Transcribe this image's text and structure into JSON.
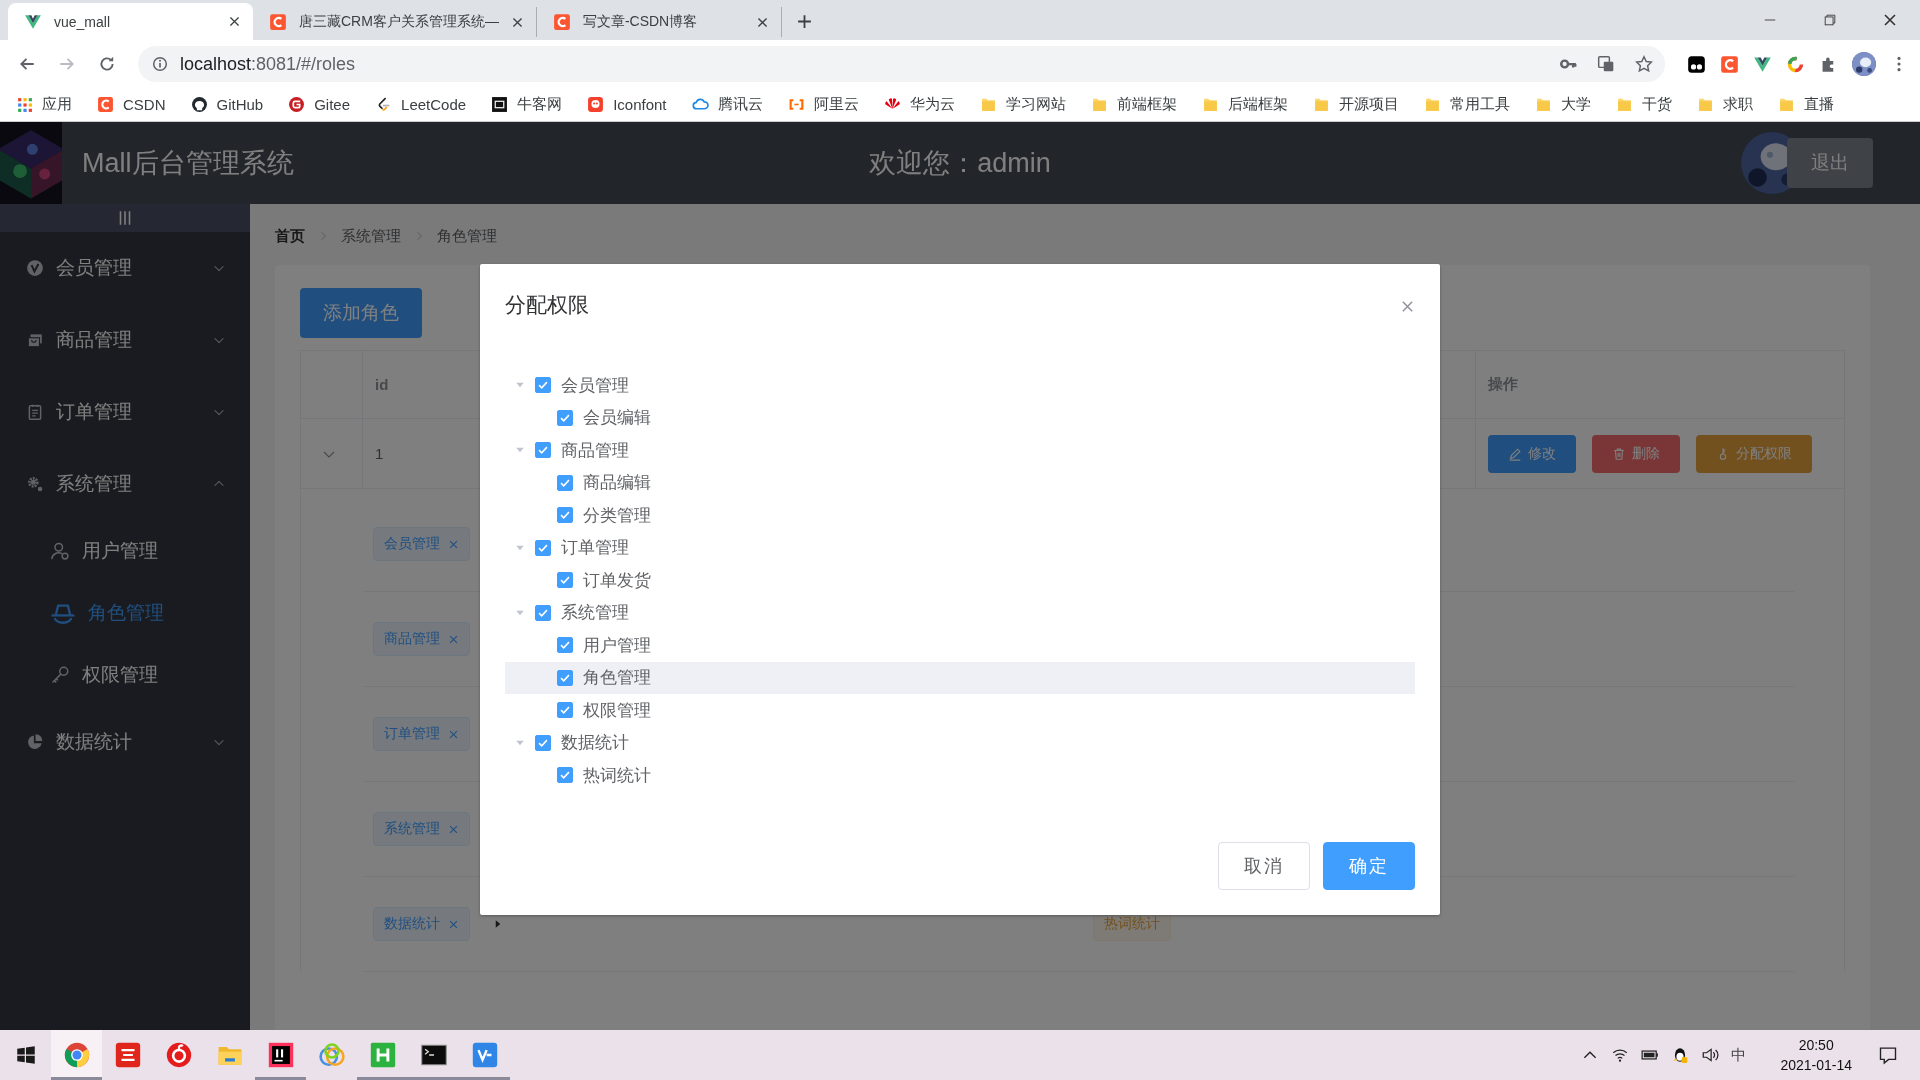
{
  "browser": {
    "tabs": [
      {
        "title": "vue_mall",
        "selected": true
      },
      {
        "title": "唐三藏CRM客户关系管理系统—",
        "selected": false
      },
      {
        "title": "写文章-CSDN博客",
        "selected": false
      }
    ],
    "address": {
      "host": "localhost",
      "path": ":8081/#/roles"
    },
    "bookmarks": [
      "应用",
      "CSDN",
      "GitHub",
      "Gitee",
      "LeetCode",
      "牛客网",
      "Iconfont",
      "腾讯云",
      "阿里云",
      "华为云",
      "学习网站",
      "前端框架",
      "后端框架",
      "开源项目",
      "常用工具",
      "大学",
      "干货",
      "求职",
      "直播"
    ]
  },
  "header": {
    "title": "Mall后台管理系统",
    "welcome": "欢迎您：admin",
    "logout": "退出"
  },
  "sidebar": {
    "items": [
      {
        "label": "会员管理",
        "expanded": false
      },
      {
        "label": "商品管理",
        "expanded": false
      },
      {
        "label": "订单管理",
        "expanded": false
      },
      {
        "label": "系统管理",
        "expanded": true,
        "children": [
          {
            "label": "用户管理",
            "selected": false
          },
          {
            "label": "角色管理",
            "selected": true
          },
          {
            "label": "权限管理",
            "selected": false
          }
        ]
      },
      {
        "label": "数据统计",
        "expanded": false
      }
    ]
  },
  "breadcrumb": [
    {
      "label": "首页",
      "link": true
    },
    {
      "label": "系统管理",
      "link": false
    },
    {
      "label": "角色管理",
      "link": false
    }
  ],
  "add_button": "添加角色",
  "table": {
    "columns": [
      "id",
      "操作"
    ],
    "rows": [
      {
        "expanded": true,
        "id": "1",
        "actions": [
          {
            "label": "修改",
            "kind": "edit"
          },
          {
            "label": "删除",
            "kind": "delete"
          },
          {
            "label": "分配权限",
            "kind": "assign"
          }
        ],
        "rights": [
          {
            "tag": "会员管理"
          },
          {
            "tag": "商品管理"
          },
          {
            "tag": "订单管理"
          },
          {
            "tag": "系统管理"
          },
          {
            "tag": "数据统计",
            "children": [
              {
                "tag": "热词统计"
              }
            ]
          }
        ]
      }
    ]
  },
  "dialog": {
    "title": "分配权限",
    "tree": [
      {
        "label": "会员管理",
        "checked": true,
        "expanded": true,
        "selected": false,
        "children": [
          {
            "label": "会员编辑",
            "checked": true,
            "selected": false
          }
        ]
      },
      {
        "label": "商品管理",
        "checked": true,
        "expanded": true,
        "selected": false,
        "children": [
          {
            "label": "商品编辑",
            "checked": true,
            "selected": false
          },
          {
            "label": "分类管理",
            "checked": true,
            "selected": false
          }
        ]
      },
      {
        "label": "订单管理",
        "checked": true,
        "expanded": true,
        "selected": false,
        "children": [
          {
            "label": "订单发货",
            "checked": true,
            "selected": false
          }
        ]
      },
      {
        "label": "系统管理",
        "checked": true,
        "expanded": true,
        "selected": false,
        "children": [
          {
            "label": "用户管理",
            "checked": true,
            "selected": false
          },
          {
            "label": "角色管理",
            "checked": true,
            "selected": true
          },
          {
            "label": "权限管理",
            "checked": true,
            "selected": false
          }
        ]
      },
      {
        "label": "数据统计",
        "checked": true,
        "expanded": true,
        "selected": false,
        "children": [
          {
            "label": "热词统计",
            "checked": true,
            "selected": false
          }
        ]
      }
    ],
    "buttons": [
      {
        "label": "取消",
        "kind": "default"
      },
      {
        "label": "确定",
        "kind": "primary"
      }
    ]
  },
  "taskbar": {
    "apps": [
      {
        "running": true,
        "selected": true
      },
      {
        "running": false,
        "selected": false
      },
      {
        "running": false,
        "selected": false
      },
      {
        "running": false,
        "selected": false
      },
      {
        "running": true,
        "selected": false
      },
      {
        "running": false,
        "selected": false
      },
      {
        "running": true,
        "selected": false
      },
      {
        "running": true,
        "selected": false
      },
      {
        "running": true,
        "selected": false
      }
    ],
    "ime": "中",
    "time": "20:50",
    "date": "2021-01-14"
  }
}
